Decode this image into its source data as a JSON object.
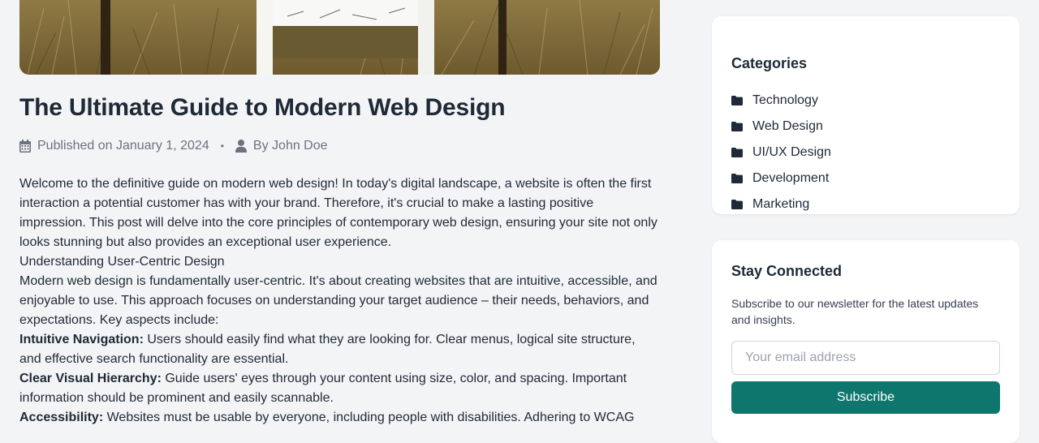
{
  "article": {
    "title": "The Ultimate Guide to Modern Web Design",
    "published": "Published on January 1, 2024",
    "separator": "•",
    "author": "By John Doe",
    "intro": "Welcome to the definitive guide on modern web design! In today's digital landscape, a website is often the first interaction a potential customer has with your brand. Therefore, it's crucial to make a lasting positive impression. This post will delve into the core principles of contemporary web design, ensuring your site not only looks stunning but also provides an exceptional user experience.",
    "heading1": "Understanding User-Centric Design",
    "para2": "Modern web design is fundamentally user-centric. It's about creating websites that are intuitive, accessible, and enjoyable to use. This approach focuses on understanding your target audience – their needs, behaviors, and expectations. Key aspects include:",
    "points": [
      {
        "label": "Intuitive Navigation:",
        "text": " Users should easily find what they are looking for. Clear menus, logical site structure, and effective search functionality are essential."
      },
      {
        "label": "Clear Visual Hierarchy:",
        "text": " Guide users' eyes through your content using size, color, and spacing. Important information should be prominent and easily scannable."
      },
      {
        "label": "Accessibility:",
        "text": " Websites must be usable by everyone, including people with disabilities. Adhering to WCAG"
      }
    ]
  },
  "sidebar": {
    "categories": {
      "title": "Categories",
      "items": [
        "Technology",
        "Web Design",
        "UI/UX Design",
        "Development",
        "Marketing"
      ]
    },
    "newsletter": {
      "title": "Stay Connected",
      "description": "Subscribe to our newsletter for the latest updates and insights.",
      "email_placeholder": "Your email address",
      "button_label": "Subscribe"
    }
  },
  "colors": {
    "accent": "#0f766e",
    "background": "#f3f4f6",
    "text": "#1f2937",
    "muted": "#6b7280"
  },
  "icons": {
    "published": "calendar-icon",
    "author": "user-icon",
    "category": "folder-icon"
  }
}
